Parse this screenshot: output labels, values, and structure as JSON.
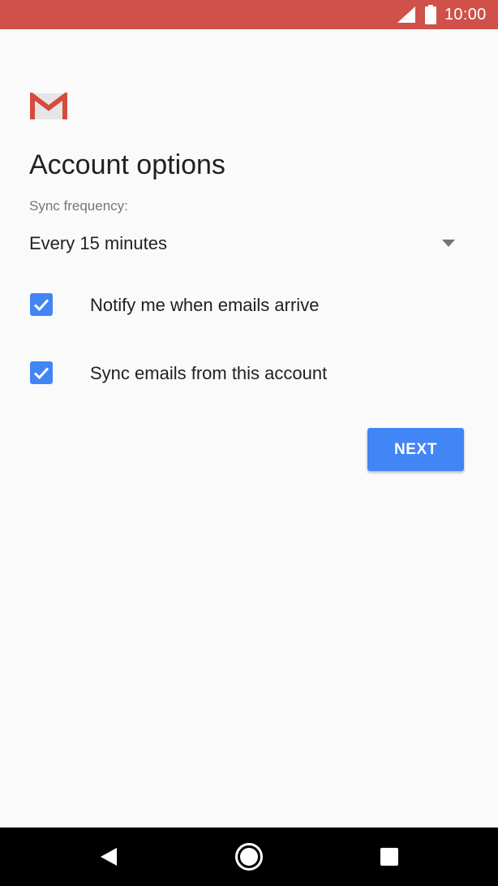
{
  "status_bar": {
    "time": "10:00",
    "signal_icon": "cell-signal-icon",
    "battery_icon": "battery-full-icon"
  },
  "logo": {
    "icon": "gmail-logo-icon"
  },
  "page": {
    "title": "Account options"
  },
  "sync": {
    "label": "Sync frequency:",
    "selected": "Every 15 minutes",
    "dropdown_icon": "dropdown-arrow-icon"
  },
  "options": [
    {
      "label": "Notify me when emails arrive",
      "checked": true
    },
    {
      "label": "Sync emails from this account",
      "checked": true
    }
  ],
  "actions": {
    "next_label": "NEXT"
  },
  "nav": {
    "back_icon": "back-triangle-icon",
    "home_icon": "home-circle-icon",
    "recents_icon": "recents-square-icon"
  },
  "colors": {
    "status_bar": "#cf5149",
    "accent": "#4285f4",
    "background": "#fafafa",
    "text_primary": "#212121",
    "text_secondary": "#757575"
  }
}
